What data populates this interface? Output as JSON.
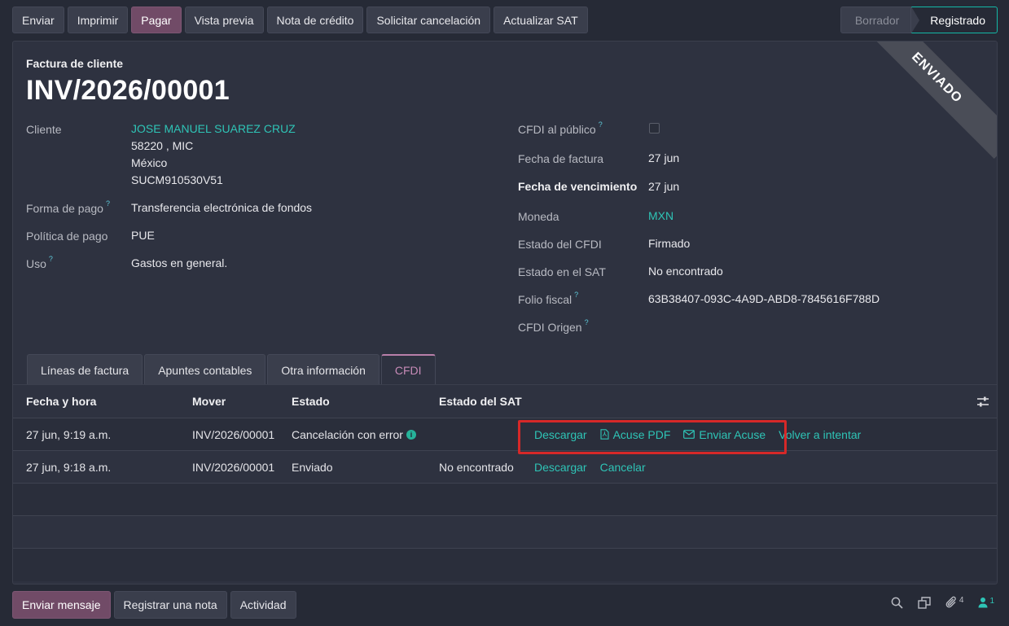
{
  "toolbar": {
    "buttons": [
      "Enviar",
      "Imprimir",
      "Pagar",
      "Vista previa",
      "Nota de crédito",
      "Solicitar cancelación",
      "Actualizar SAT"
    ],
    "primary_index": 2
  },
  "status": {
    "stages": [
      "Borrador",
      "Registrado"
    ],
    "active": "Registrado"
  },
  "ribbon": "ENVIADO",
  "document": {
    "type": "Factura de cliente",
    "number": "INV/2026/00001"
  },
  "left_fields": {
    "cliente_label": "Cliente",
    "cliente_name": "JOSE MANUEL SUAREZ CRUZ",
    "cliente_addr1": "58220 , MIC",
    "cliente_addr2": "México",
    "cliente_rfc": "SUCM910530V51",
    "forma_pago_label": "Forma de pago",
    "forma_pago_value": "Transferencia electrónica de fondos",
    "politica_label": "Política de pago",
    "politica_value": "PUE",
    "uso_label": "Uso",
    "uso_value": "Gastos en general."
  },
  "right_fields": {
    "publico_label": "CFDI al público",
    "fecha_factura_label": "Fecha de factura",
    "fecha_factura_value": "27 jun",
    "vencimiento_label": "Fecha de vencimiento",
    "vencimiento_value": "27 jun",
    "moneda_label": "Moneda",
    "moneda_value": "MXN",
    "estado_cfdi_label": "Estado del CFDI",
    "estado_cfdi_value": "Firmado",
    "estado_sat_label": "Estado en el SAT",
    "estado_sat_value": "No encontrado",
    "folio_label": "Folio fiscal",
    "folio_value": "63B38407-093C-4A9D-ABD8-7845616F788D",
    "origen_label": "CFDI Origen"
  },
  "help_mark": "?",
  "tabs": [
    "Líneas de factura",
    "Apuntes contables",
    "Otra información",
    "CFDI"
  ],
  "active_tab": "CFDI",
  "table": {
    "headers": [
      "Fecha y hora",
      "Mover",
      "Estado",
      "Estado del SAT"
    ],
    "rows": [
      {
        "fecha": "27 jun, 9:19 a.m.",
        "mover": "INV/2026/00001",
        "estado": "Cancelación con error",
        "sat": "",
        "actions": [
          "Descargar",
          "Acuse PDF",
          "Enviar Acuse",
          "Volver a intentar"
        ]
      },
      {
        "fecha": "27 jun, 9:18 a.m.",
        "mover": "INV/2026/00001",
        "estado": "Enviado",
        "sat": "No encontrado",
        "actions": [
          "Descargar",
          "Cancelar"
        ]
      }
    ]
  },
  "chatter": {
    "buttons": [
      "Enviar mensaje",
      "Registrar una nota",
      "Actividad"
    ]
  },
  "bottom_counts": {
    "attachments": "4",
    "followers": "1"
  }
}
